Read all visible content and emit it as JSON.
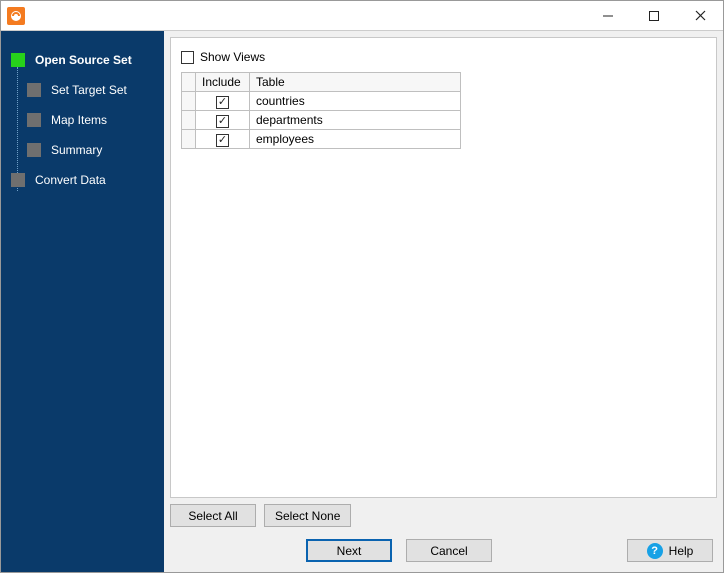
{
  "titlebar": {
    "title": ""
  },
  "sidebar": {
    "steps": [
      {
        "label": "Open Source Set",
        "active": true
      },
      {
        "label": "Set Target Set",
        "active": false
      },
      {
        "label": "Map Items",
        "active": false
      },
      {
        "label": "Summary",
        "active": false
      },
      {
        "label": "Convert Data",
        "active": false
      }
    ]
  },
  "main": {
    "show_views_label": "Show Views",
    "show_views_checked": false,
    "columns": {
      "include": "Include",
      "table": "Table"
    },
    "rows": [
      {
        "include": true,
        "table": "countries"
      },
      {
        "include": true,
        "table": "departments"
      },
      {
        "include": true,
        "table": "employees"
      }
    ],
    "select_all_label": "Select All",
    "select_none_label": "Select None"
  },
  "footer": {
    "next_label": "Next",
    "cancel_label": "Cancel",
    "help_label": "Help"
  }
}
